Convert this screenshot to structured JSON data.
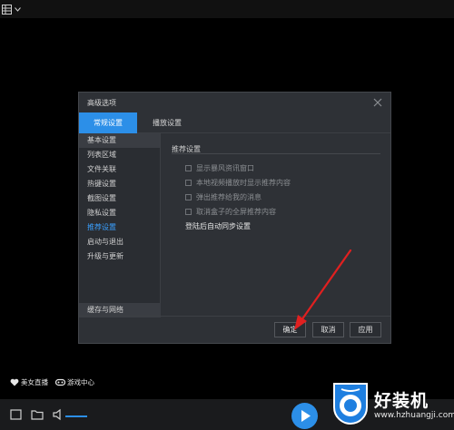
{
  "dialog": {
    "title": "高级选项",
    "tabs": [
      {
        "label": "常规设置",
        "active": true
      },
      {
        "label": "播放设置",
        "active": false
      }
    ],
    "sidebar": {
      "items": [
        "基本设置",
        "列表区域",
        "文件关联",
        "热键设置",
        "截图设置",
        "隐私设置",
        "推荐设置",
        "启动与退出",
        "升级与更新"
      ],
      "active_item": "推荐设置",
      "bottom_item": "缓存与网络"
    },
    "section": {
      "title": "推荐设置",
      "options": [
        {
          "label": "显示暴风资讯窗口",
          "checked": false
        },
        {
          "label": "本地视频播放时显示推荐内容",
          "checked": false
        },
        {
          "label": "弹出推荐给我的消息",
          "checked": false
        },
        {
          "label": "取消盒子的全屏推荐内容",
          "checked": false
        }
      ],
      "sync_label": "登陆后自动同步设置"
    },
    "buttons": {
      "ok": "确定",
      "cancel": "取消",
      "apply": "应用"
    }
  },
  "bottom": {
    "brand_left": "美女直播",
    "brand_right": "游戏中心",
    "volume_level": 1.0
  },
  "watermark": {
    "text": "好装机",
    "url": "www.hzhuangji.com"
  },
  "colors": {
    "accent": "#2c8fe8",
    "dialog_bg": "#2e3136",
    "arrow": "#e02020"
  }
}
